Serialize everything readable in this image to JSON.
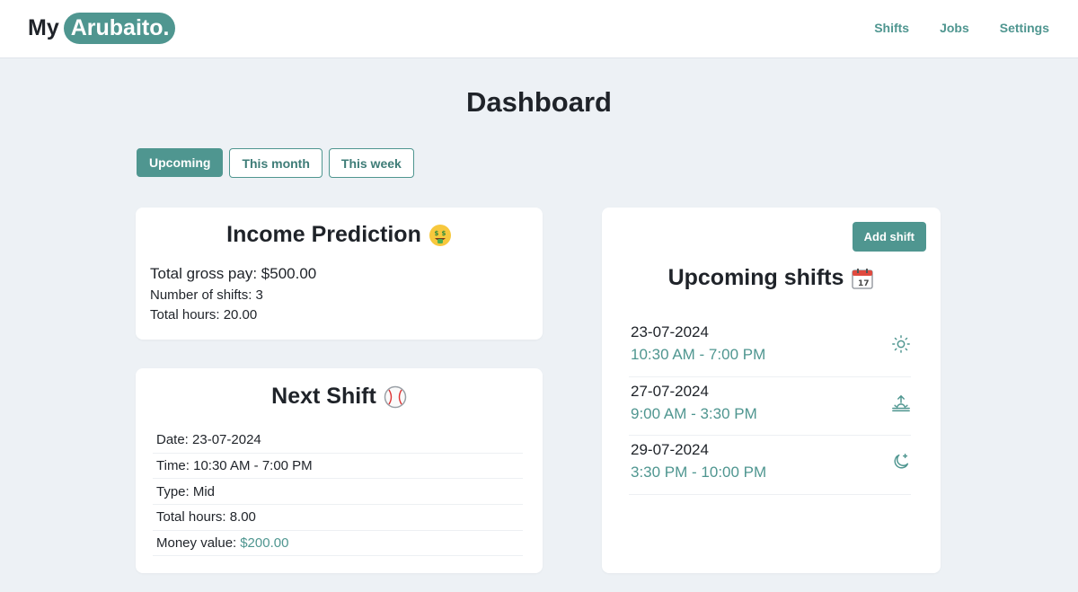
{
  "brand": {
    "prefix": "My",
    "name": "Arubaito."
  },
  "nav": {
    "shifts": "Shifts",
    "jobs": "Jobs",
    "settings": "Settings"
  },
  "page": {
    "title": "Dashboard"
  },
  "tabs": [
    {
      "label": "Upcoming",
      "active": true
    },
    {
      "label": "This month",
      "active": false
    },
    {
      "label": "This week",
      "active": false
    }
  ],
  "income": {
    "title": "Income Prediction",
    "title_icon": "money-mouth-face-icon",
    "gross": "Total gross pay: $500.00",
    "shift_count": "Number of shifts: 3",
    "hours": "Total hours: 20.00"
  },
  "next_shift": {
    "title": "Next Shift",
    "title_icon": "baseball-icon",
    "date": "Date: 23-07-2024",
    "time": "Time: 10:30 AM - 7:00 PM",
    "type": "Type: Mid",
    "hours": "Total hours: 8.00",
    "money_label": "Money value:",
    "money_value": "$200.00"
  },
  "upcoming": {
    "add_button": "Add shift",
    "title": "Upcoming shifts",
    "title_icon": "calendar-icon",
    "shifts": [
      {
        "date": "23-07-2024",
        "time": "10:30 AM - 7:00 PM",
        "icon": "sun-icon"
      },
      {
        "date": "27-07-2024",
        "time": "9:00 AM - 3:30 PM",
        "icon": "sunrise-icon"
      },
      {
        "date": "29-07-2024",
        "time": "3:30 PM - 10:00 PM",
        "icon": "moon-star-icon"
      }
    ]
  },
  "colors": {
    "accent": "#4f9690",
    "background": "#edf1f5",
    "card": "#ffffff",
    "text": "#1f2329"
  }
}
